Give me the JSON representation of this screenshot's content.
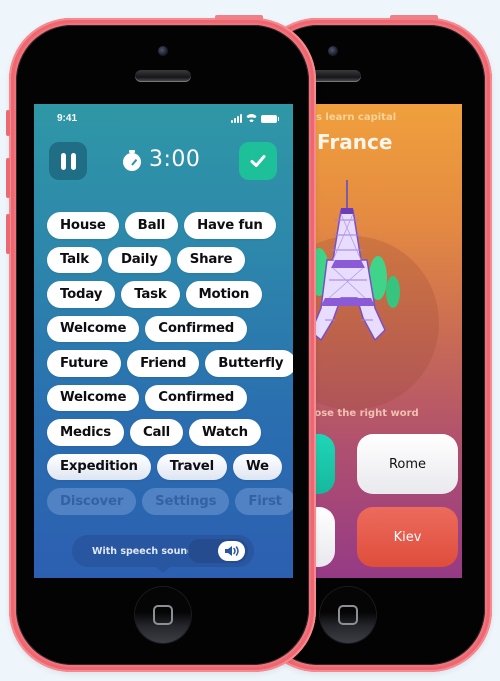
{
  "front_screen": {
    "status_bar": {
      "time": "9:41",
      "icons": [
        "signal-icon",
        "wifi-icon",
        "battery-icon"
      ]
    },
    "header": {
      "pause_icon": "pause-icon",
      "timer_icon": "stopwatch-icon",
      "timer_value": "3:00",
      "confirm_icon": "checkmark-icon"
    },
    "word_rows": [
      [
        "House",
        "Ball",
        "Have fun"
      ],
      [
        "Talk",
        "Daily",
        "Share"
      ],
      [
        "Today",
        "Task",
        "Motion"
      ],
      [
        "Welcome",
        "Confirmed"
      ],
      [
        "Future",
        "Friend",
        "Butterfly"
      ],
      [
        "Welcome",
        "Confirmed"
      ],
      [
        "Medics",
        "Call",
        "Watch"
      ],
      [
        "Expedition",
        "Travel",
        "We"
      ],
      [
        "Discover",
        "Settings",
        "First"
      ]
    ],
    "speech_sound": {
      "label": "With speech sound",
      "enabled": true,
      "icon": "speaker-icon"
    }
  },
  "back_screen": {
    "subtitle": "Let's learn capital",
    "title": "France",
    "illustration": "eiffel-tower",
    "prompt": "Choose the right word",
    "answers": [
      {
        "label": "",
        "style": "teal"
      },
      {
        "label": "Rome",
        "style": "white"
      },
      {
        "label": "",
        "style": "white"
      },
      {
        "label": "Kiev",
        "style": "red"
      }
    ]
  },
  "colors": {
    "phone_shell": "#f3727a",
    "confirm_green": "#1ec09a",
    "wrong_red": "#e55a49",
    "front_gradient_top": "#2f97a6",
    "front_gradient_bottom": "#2c5fb1",
    "back_gradient_top": "#f0a03c",
    "back_gradient_bottom": "#963a86"
  }
}
